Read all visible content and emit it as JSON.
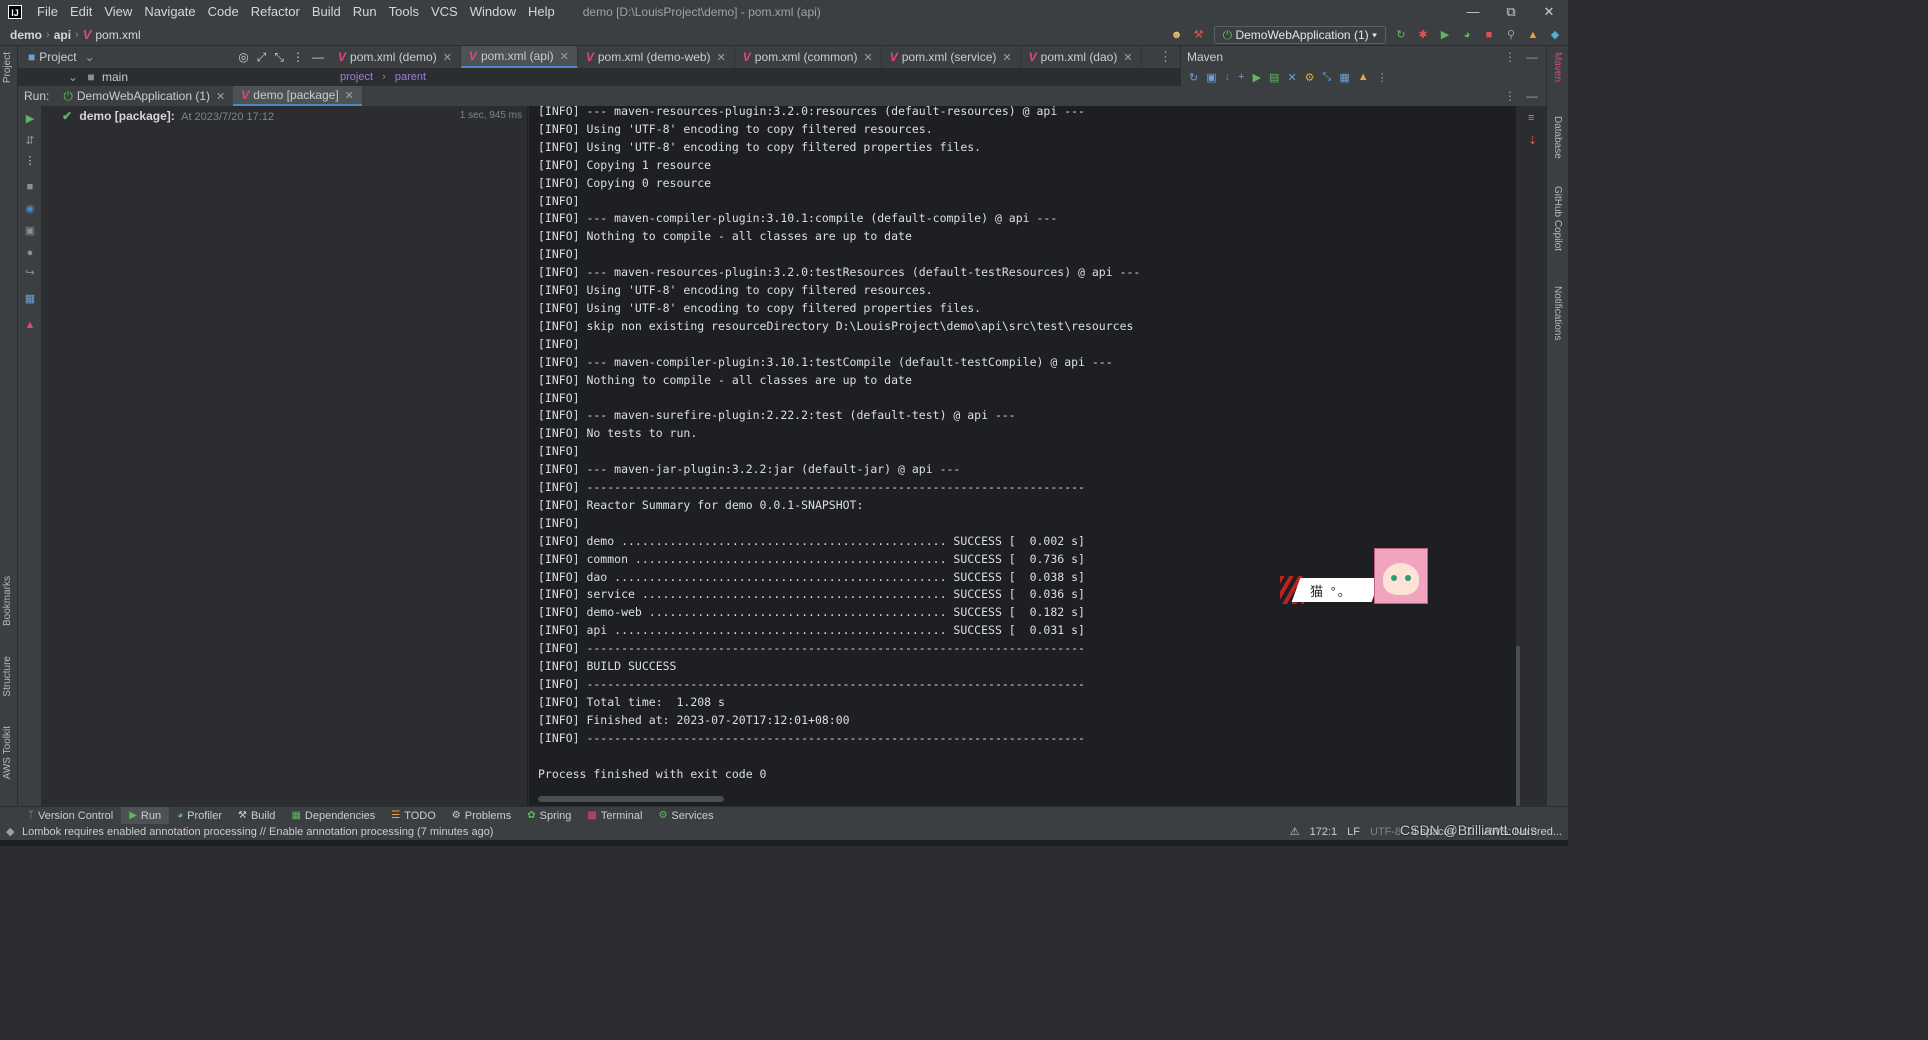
{
  "title_bar": {
    "logo": "IJ",
    "menu": [
      "File",
      "Edit",
      "View",
      "Navigate",
      "Code",
      "Refactor",
      "Build",
      "Run",
      "Tools",
      "VCS",
      "Window",
      "Help"
    ],
    "window_title": "demo [D:\\LouisProject\\demo] - pom.xml (api)"
  },
  "nav": {
    "crumbs": [
      "demo",
      "api",
      "pom.xml"
    ],
    "run_config": "DemoWebApplication (1)"
  },
  "project_panel": {
    "title": "Project",
    "tree_item": "main"
  },
  "editor": {
    "tabs": [
      {
        "label": "pom.xml (demo)",
        "active": false
      },
      {
        "label": "pom.xml (api)",
        "active": true
      },
      {
        "label": "pom.xml (demo-web)",
        "active": false
      },
      {
        "label": "pom.xml (common)",
        "active": false
      },
      {
        "label": "pom.xml (service)",
        "active": false
      },
      {
        "label": "pom.xml (dao)",
        "active": false
      }
    ],
    "breadcrumb": [
      "project",
      "parent"
    ]
  },
  "maven_panel": {
    "title": "Maven"
  },
  "run_window": {
    "label": "Run:",
    "tabs": [
      {
        "label": "DemoWebApplication (1)",
        "active": false
      },
      {
        "label": "demo [package]",
        "active": true
      }
    ],
    "tree": {
      "title": "demo [package]:",
      "meta": "At 2023/7/20 17:12",
      "time": "1 sec, 945 ms"
    },
    "console_lines": [
      "[INFO] --- maven-resources-plugin:3.2.0:resources (default-resources) @ api ---",
      "[INFO] Using 'UTF-8' encoding to copy filtered resources.",
      "[INFO] Using 'UTF-8' encoding to copy filtered properties files.",
      "[INFO] Copying 1 resource",
      "[INFO] Copying 0 resource",
      "[INFO]",
      "[INFO] --- maven-compiler-plugin:3.10.1:compile (default-compile) @ api ---",
      "[INFO] Nothing to compile - all classes are up to date",
      "[INFO]",
      "[INFO] --- maven-resources-plugin:3.2.0:testResources (default-testResources) @ api ---",
      "[INFO] Using 'UTF-8' encoding to copy filtered resources.",
      "[INFO] Using 'UTF-8' encoding to copy filtered properties files.",
      "[INFO] skip non existing resourceDirectory D:\\LouisProject\\demo\\api\\src\\test\\resources",
      "[INFO]",
      "[INFO] --- maven-compiler-plugin:3.10.1:testCompile (default-testCompile) @ api ---",
      "[INFO] Nothing to compile - all classes are up to date",
      "[INFO]",
      "[INFO] --- maven-surefire-plugin:2.22.2:test (default-test) @ api ---",
      "[INFO] No tests to run.",
      "[INFO]",
      "[INFO] --- maven-jar-plugin:3.2.2:jar (default-jar) @ api ---",
      "[INFO] ------------------------------------------------------------------------",
      "[INFO] Reactor Summary for demo 0.0.1-SNAPSHOT:",
      "[INFO]",
      "[INFO] demo ............................................... SUCCESS [  0.002 s]",
      "[INFO] common ............................................. SUCCESS [  0.736 s]",
      "[INFO] dao ................................................ SUCCESS [  0.038 s]",
      "[INFO] service ............................................ SUCCESS [  0.036 s]",
      "[INFO] demo-web ........................................... SUCCESS [  0.182 s]",
      "[INFO] api ................................................ SUCCESS [  0.031 s]",
      "[INFO] ------------------------------------------------------------------------",
      "[INFO] BUILD SUCCESS",
      "[INFO] ------------------------------------------------------------------------",
      "[INFO] Total time:  1.208 s",
      "[INFO] Finished at: 2023-07-20T17:12:01+08:00",
      "[INFO] ------------------------------------------------------------------------",
      "",
      "Process finished with exit code 0"
    ]
  },
  "left_strip": {
    "labels": [
      "Project",
      "Bookmarks",
      "Structure",
      "AWS Toolkit"
    ]
  },
  "right_strip": {
    "labels": [
      "Maven",
      "Database",
      "GitHub Copilot",
      "Notifications"
    ]
  },
  "widget": {
    "text": "猫 °。"
  },
  "bottom_tabs": [
    {
      "label": "Version Control",
      "icon": "branch-icon"
    },
    {
      "label": "Run",
      "icon": "play-icon",
      "active": true
    },
    {
      "label": "Profiler",
      "icon": "profiler-icon"
    },
    {
      "label": "Build",
      "icon": "hammer-icon"
    },
    {
      "label": "Dependencies",
      "icon": "dependencies-icon"
    },
    {
      "label": "TODO",
      "icon": "todo-icon"
    },
    {
      "label": "Problems",
      "icon": "problems-icon"
    },
    {
      "label": "Spring",
      "icon": "spring-icon"
    },
    {
      "label": "Terminal",
      "icon": "terminal-icon"
    },
    {
      "label": "Services",
      "icon": "services-icon"
    }
  ],
  "status": {
    "message": "Lombok requires enabled annotation processing // Enable annotation processing (7 minutes ago)",
    "position": "172:1",
    "line_sep": "LF",
    "encoding": "UTF-8",
    "indent": "4 spaces",
    "aws": "AWS: No cred...",
    "watermark": "CSDN @BrilliantLouis"
  },
  "colors": {
    "accent": "#4a88c7",
    "success": "#5fb760",
    "maven": "#e0457b",
    "console_bg": "#1e1f22",
    "panel_bg": "#2b2d30"
  }
}
